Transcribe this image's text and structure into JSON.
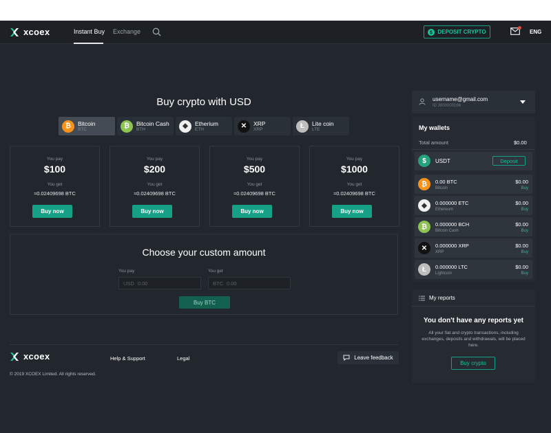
{
  "brand": {
    "name": "xcoex"
  },
  "header": {
    "tabs": [
      {
        "label": "Instant Buy",
        "active": true
      },
      {
        "label": "Exchange",
        "active": false
      }
    ],
    "deposit_label": "DEPOSIT CRYPTO",
    "language": "ENG"
  },
  "main": {
    "title": "Buy crypto with USD",
    "coins": [
      {
        "name": "Bitcoin",
        "symbol": "BTC",
        "icon": "bitcoin-icon",
        "color": "#f7931a"
      },
      {
        "name": "Bitcoin Cash",
        "symbol": "BTH",
        "icon": "bitcoin-cash-icon",
        "color": "#8dc351"
      },
      {
        "name": "Etherium",
        "symbol": "ETH",
        "icon": "ethereum-icon",
        "color": "#f0f0f0"
      },
      {
        "name": "XRP",
        "symbol": "XRP",
        "icon": "xrp-icon",
        "color": "#111111"
      },
      {
        "name": "Lite coin",
        "symbol": "LTE",
        "icon": "litecoin-icon",
        "color": "#bebebe"
      }
    ],
    "cards": [
      {
        "pay_label": "You pay",
        "amount": "$100",
        "get_label": "You get",
        "get_value": "≈0.02409698 BTC",
        "button": "Buy now"
      },
      {
        "pay_label": "You pay",
        "amount": "$200",
        "get_label": "You get",
        "get_value": "≈0.02409698 BTC",
        "button": "Buy now"
      },
      {
        "pay_label": "You pay",
        "amount": "$500",
        "get_label": "You get",
        "get_value": "≈0.02409698 BTC",
        "button": "Buy now"
      },
      {
        "pay_label": "You pay",
        "amount": "$1000",
        "get_label": "You get",
        "get_value": "≈0.02409698 BTC",
        "button": "Buy now"
      }
    ],
    "custom": {
      "title": "Choose your custom amount",
      "pay_label": "You pay",
      "pay_currency": "USD",
      "pay_value": "0.00",
      "get_label": "You get",
      "get_currency": "BTC",
      "get_value": "0.00",
      "button": "Buy BTC"
    }
  },
  "footer": {
    "links": [
      "Help & Support",
      "Legal"
    ],
    "feedback": "Leave feedback",
    "copyright": "© 2019 XCOEX Limited. All rights reserved."
  },
  "account": {
    "email": "username@gmail.com",
    "id": "ID 3800000196"
  },
  "wallets": {
    "title": "My wallets",
    "total_label": "Total amount",
    "total_value": "$0.00",
    "usdt": {
      "name": "USDT",
      "button": "Deposit",
      "color": "#26a17b"
    },
    "items": [
      {
        "amount": "0.00 BTC",
        "name": "Bitcoin",
        "value": "$0.00",
        "action": "Buy",
        "icon": "bitcoin-icon",
        "color": "#f7931a",
        "glyph": "₿"
      },
      {
        "amount": "0.000000 ETC",
        "name": "Ethereum",
        "value": "$0.00",
        "action": "Buy",
        "icon": "ethereum-icon",
        "color": "#f0f0f0",
        "glyph": "◆"
      },
      {
        "amount": "0.000000 BCH",
        "name": "Bitcoin Cash",
        "value": "$0.00",
        "action": "Buy",
        "icon": "bitcoin-cash-icon",
        "color": "#8dc351",
        "glyph": "₿"
      },
      {
        "amount": "0.000000 XRP",
        "name": "XRP",
        "value": "$0.00",
        "action": "Buy",
        "icon": "xrp-icon",
        "color": "#111111",
        "glyph": "✕"
      },
      {
        "amount": "0.000000 LTC",
        "name": "Lightcoin",
        "value": "$0.00",
        "action": "Buy",
        "icon": "litecoin-icon",
        "color": "#bebebe",
        "glyph": "Ł"
      }
    ]
  },
  "reports": {
    "title": "My reports",
    "empty_title": "You don't have any reports yet",
    "empty_desc": "All your fiat and crypto transactions, including exchanges, deposits and withdrawals, will be placed here.",
    "button": "Buy crypto"
  },
  "colors": {
    "accent": "#16a085",
    "background": "#22272e",
    "panel": "#262b32"
  }
}
